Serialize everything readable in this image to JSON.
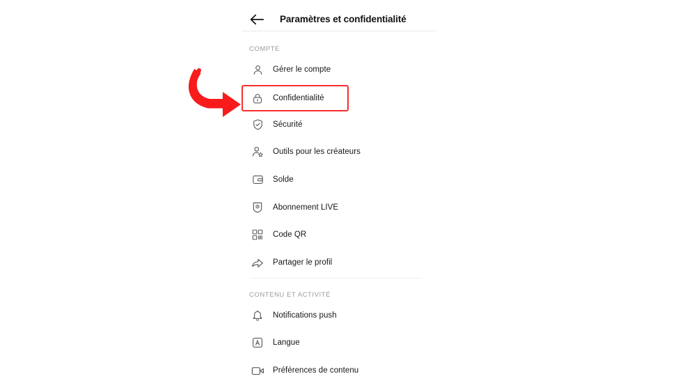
{
  "header": {
    "back_icon": "arrow-left-icon",
    "title": "Paramètres et confidentialité"
  },
  "sections": [
    {
      "label": "COMPTE",
      "items": [
        {
          "icon": "person-icon",
          "label": "Gérer le compte"
        },
        {
          "icon": "lock-icon",
          "label": "Confidentialité",
          "highlighted": true
        },
        {
          "icon": "shield-check-icon",
          "label": "Sécurité"
        },
        {
          "icon": "person-star-icon",
          "label": "Outils pour les créateurs"
        },
        {
          "icon": "wallet-icon",
          "label": "Solde"
        },
        {
          "icon": "shield-live-icon",
          "label": "Abonnement LIVE"
        },
        {
          "icon": "qr-code-icon",
          "label": "Code QR"
        },
        {
          "icon": "share-arrow-icon",
          "label": "Partager le profil"
        }
      ]
    },
    {
      "label": "CONTENU ET ACTIVITÉ",
      "items": [
        {
          "icon": "bell-icon",
          "label": "Notifications push"
        },
        {
          "icon": "language-icon",
          "label": "Langue"
        },
        {
          "icon": "video-icon",
          "label": "Préférences de contenu"
        }
      ]
    }
  ],
  "annotation": {
    "type": "curved-arrow",
    "color": "#f81b1b",
    "points_to": "Confidentialité",
    "highlight_color": "#fa2d2d"
  },
  "colors": {
    "background": "#ffffff",
    "title_text": "#111111",
    "item_text": "#161616",
    "section_text": "#9b9b9b",
    "icon": "#5a5a5a",
    "divider": "#e8e8e8",
    "accent_red": "#f81b1b"
  }
}
